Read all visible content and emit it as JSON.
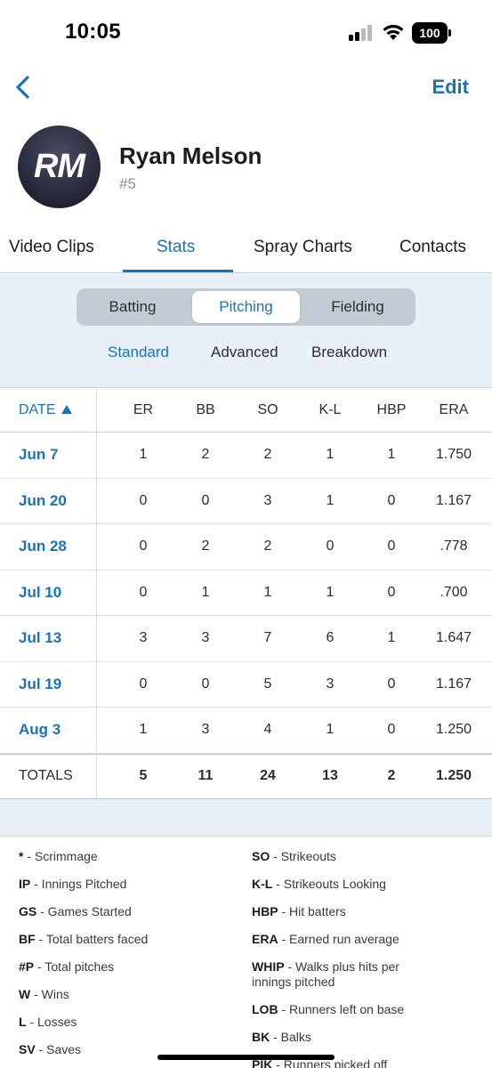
{
  "status": {
    "time": "10:05",
    "battery": "100"
  },
  "nav": {
    "edit_label": "Edit"
  },
  "profile": {
    "initials": "RM",
    "name": "Ryan Melson",
    "number": "#5"
  },
  "tabs": [
    "Video Clips",
    "Stats",
    "Spray Charts",
    "Contacts"
  ],
  "active_tab": "Stats",
  "segments": [
    "Batting",
    "Pitching",
    "Fielding"
  ],
  "active_segment": "Pitching",
  "subtabs": [
    "Standard",
    "Advanced",
    "Breakdown"
  ],
  "active_subtab": "Standard",
  "table": {
    "headers": [
      "DATE",
      "ER",
      "BB",
      "SO",
      "K-L",
      "HBP",
      "ERA"
    ],
    "rows": [
      [
        "Jun 7",
        "1",
        "2",
        "2",
        "1",
        "1",
        "1.750"
      ],
      [
        "Jun 20",
        "0",
        "0",
        "3",
        "1",
        "0",
        "1.167"
      ],
      [
        "Jun 28",
        "0",
        "2",
        "2",
        "0",
        "0",
        ".778"
      ],
      [
        "Jul 10",
        "0",
        "1",
        "1",
        "1",
        "0",
        ".700"
      ],
      [
        "Jul 13",
        "3",
        "3",
        "7",
        "6",
        "1",
        "1.647"
      ],
      [
        "Jul 19",
        "0",
        "0",
        "5",
        "3",
        "0",
        "1.167"
      ],
      [
        "Aug 3",
        "1",
        "3",
        "4",
        "1",
        "0",
        "1.250"
      ]
    ],
    "totals": [
      "TOTALS",
      "5",
      "11",
      "24",
      "13",
      "2",
      "1.250"
    ]
  },
  "legend": {
    "left": [
      {
        "abbr": "*",
        "desc": " - Scrimmage"
      },
      {
        "abbr": "IP",
        "desc": " - Innings Pitched"
      },
      {
        "abbr": "GS",
        "desc": " - Games Started"
      },
      {
        "abbr": "BF",
        "desc": " - Total batters faced"
      },
      {
        "abbr": "#P",
        "desc": " - Total pitches"
      },
      {
        "abbr": "W",
        "desc": " - Wins"
      },
      {
        "abbr": "L",
        "desc": " - Losses"
      },
      {
        "abbr": "SV",
        "desc": " - Saves"
      }
    ],
    "right": [
      {
        "abbr": "SO",
        "desc": " - Strikeouts"
      },
      {
        "abbr": "K-L",
        "desc": " - Strikeouts Looking"
      },
      {
        "abbr": "HBP",
        "desc": " - Hit batters"
      },
      {
        "abbr": "ERA",
        "desc": " - Earned run average"
      },
      {
        "abbr": "WHIP",
        "desc": " - Walks plus hits per innings pitched"
      },
      {
        "abbr": "LOB",
        "desc": " - Runners left on base"
      },
      {
        "abbr": "BK",
        "desc": " - Balks"
      },
      {
        "abbr": "PIK",
        "desc": " - Runners picked off"
      }
    ]
  },
  "colors": {
    "accent": "#1a73b8",
    "panel_bg": "#e9eff6",
    "text": "#1c1c1e"
  },
  "icons": [
    "back-chevron-icon",
    "cellular-signal-icon",
    "wifi-icon",
    "battery-icon",
    "sort-ascending-icon"
  ]
}
